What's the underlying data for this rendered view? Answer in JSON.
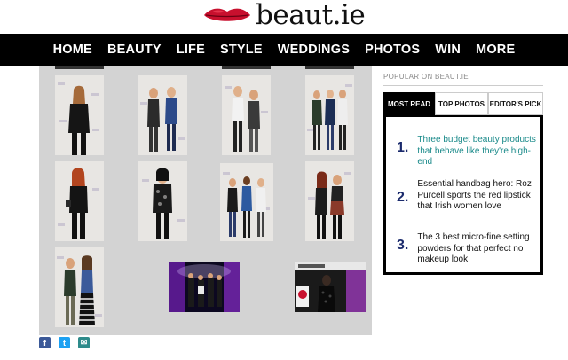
{
  "brand": {
    "name": "beaut.ie",
    "lip_color": "#c8102e"
  },
  "nav": {
    "items": [
      "HOME",
      "BEAUTY",
      "LIFE",
      "STYLE",
      "WEDDINGS",
      "PHOTOS",
      "WIN",
      "MORE"
    ]
  },
  "sidebar": {
    "heading": "POPULAR ON BEAUT.IE",
    "tabs": [
      {
        "label": "MOST READ",
        "active": true
      },
      {
        "label": "TOP PHOTOS",
        "active": false
      },
      {
        "label": "EDITOR'S PICK",
        "active": false
      }
    ],
    "articles": [
      {
        "num": "1.",
        "title": "Three budget beauty products that behave like they're high-end"
      },
      {
        "num": "2.",
        "title": "Essential handbag hero: Roz Purcell sports the red lipstick that Irish women love"
      },
      {
        "num": "3.",
        "title": "The 3 best micro-fine setting powders for that perfect no makeup look"
      }
    ]
  },
  "share": {
    "facebook": "f",
    "twitter": "t",
    "email": "✉"
  },
  "colors": {
    "nav_bg": "#000000",
    "gallery_bg": "#d3d3d3",
    "link_teal": "#1a8a8a",
    "number_navy": "#1a2a6c"
  }
}
